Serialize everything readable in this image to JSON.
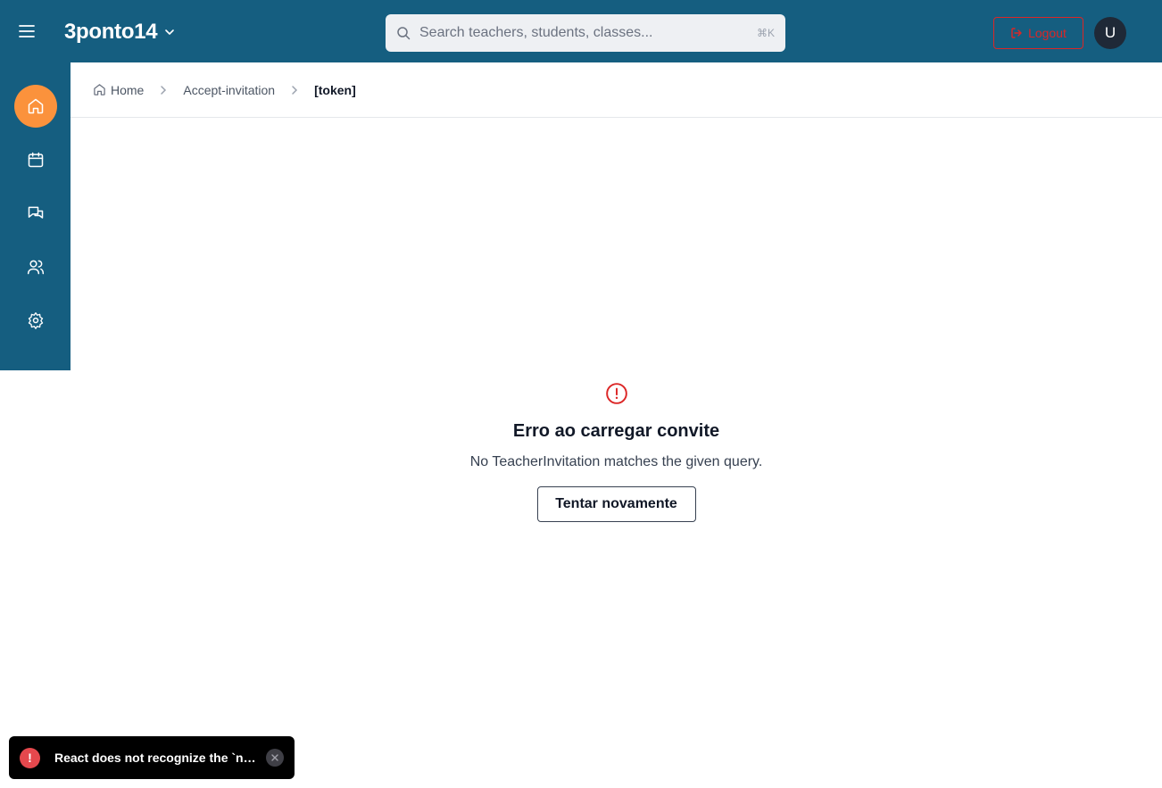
{
  "header": {
    "menu_icon": "hamburger-menu-icon",
    "brand": "3ponto14",
    "search_placeholder": "Search teachers, students, classes...",
    "search_shortcut": "⌘K",
    "logout_label": "Logout",
    "avatar_initial": "U"
  },
  "sidebar": {
    "items": [
      {
        "icon": "home-icon",
        "active": true
      },
      {
        "icon": "calendar-icon",
        "active": false
      },
      {
        "icon": "messages-icon",
        "active": false
      },
      {
        "icon": "users-icon",
        "active": false
      },
      {
        "icon": "settings-icon",
        "active": false
      }
    ]
  },
  "breadcrumb": {
    "items": [
      "Home",
      "Accept-invitation",
      "[token]"
    ]
  },
  "error": {
    "title": "Erro ao carregar convite",
    "message": "No TeacherInvitation matches the given query.",
    "retry_label": "Tentar novamente"
  },
  "toast": {
    "message": "React does not recognize the `numberOfMonths` prop on a DOM element."
  },
  "colors": {
    "header_bg": "#155e80",
    "active_nav": "#fb923c",
    "danger": "#dc2626"
  }
}
